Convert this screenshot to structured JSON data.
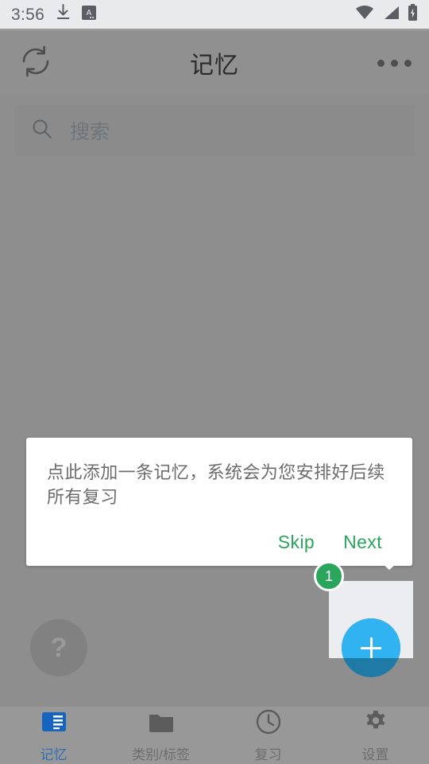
{
  "status_bar": {
    "time": "3:56",
    "icons_left": [
      "download-icon",
      "app-a-icon"
    ],
    "icons_right": [
      "wifi-icon",
      "signal-icon",
      "battery-charging-icon"
    ]
  },
  "app_bar": {
    "title": "记忆",
    "sync_icon": "sync-icon",
    "overflow_icon": "overflow-menu-icon"
  },
  "search": {
    "placeholder": "搜索",
    "icon": "search-icon",
    "value": ""
  },
  "coachmark": {
    "text": "点此添加一条记忆，系统会为您安排好后续所有复习",
    "skip_label": "Skip",
    "next_label": "Next",
    "step_badge": "1",
    "accent_color": "#2aa65c",
    "card_background": "#ffffff"
  },
  "fab": {
    "name": "add-memory-fab",
    "glyph": "+",
    "color": "#31b3f2",
    "dim_color": "#1f7ba6"
  },
  "help_fab": {
    "glyph": "?",
    "name": "help-fab"
  },
  "bottom_nav": {
    "items": [
      {
        "label": "记忆",
        "icon": "reader-mode-icon",
        "active": true
      },
      {
        "label": "类别/标签",
        "icon": "folder-icon",
        "active": false
      },
      {
        "label": "复习",
        "icon": "clock-icon",
        "active": false
      },
      {
        "label": "设置",
        "icon": "gear-icon",
        "active": false
      }
    ],
    "active_color": "#2f6fb5",
    "inactive_color": "#6d6d6d"
  },
  "theme": {
    "scrim": "#8e8e8e",
    "status_bar_bg": "#e8eaec",
    "app_bar_bg": "#909090"
  }
}
